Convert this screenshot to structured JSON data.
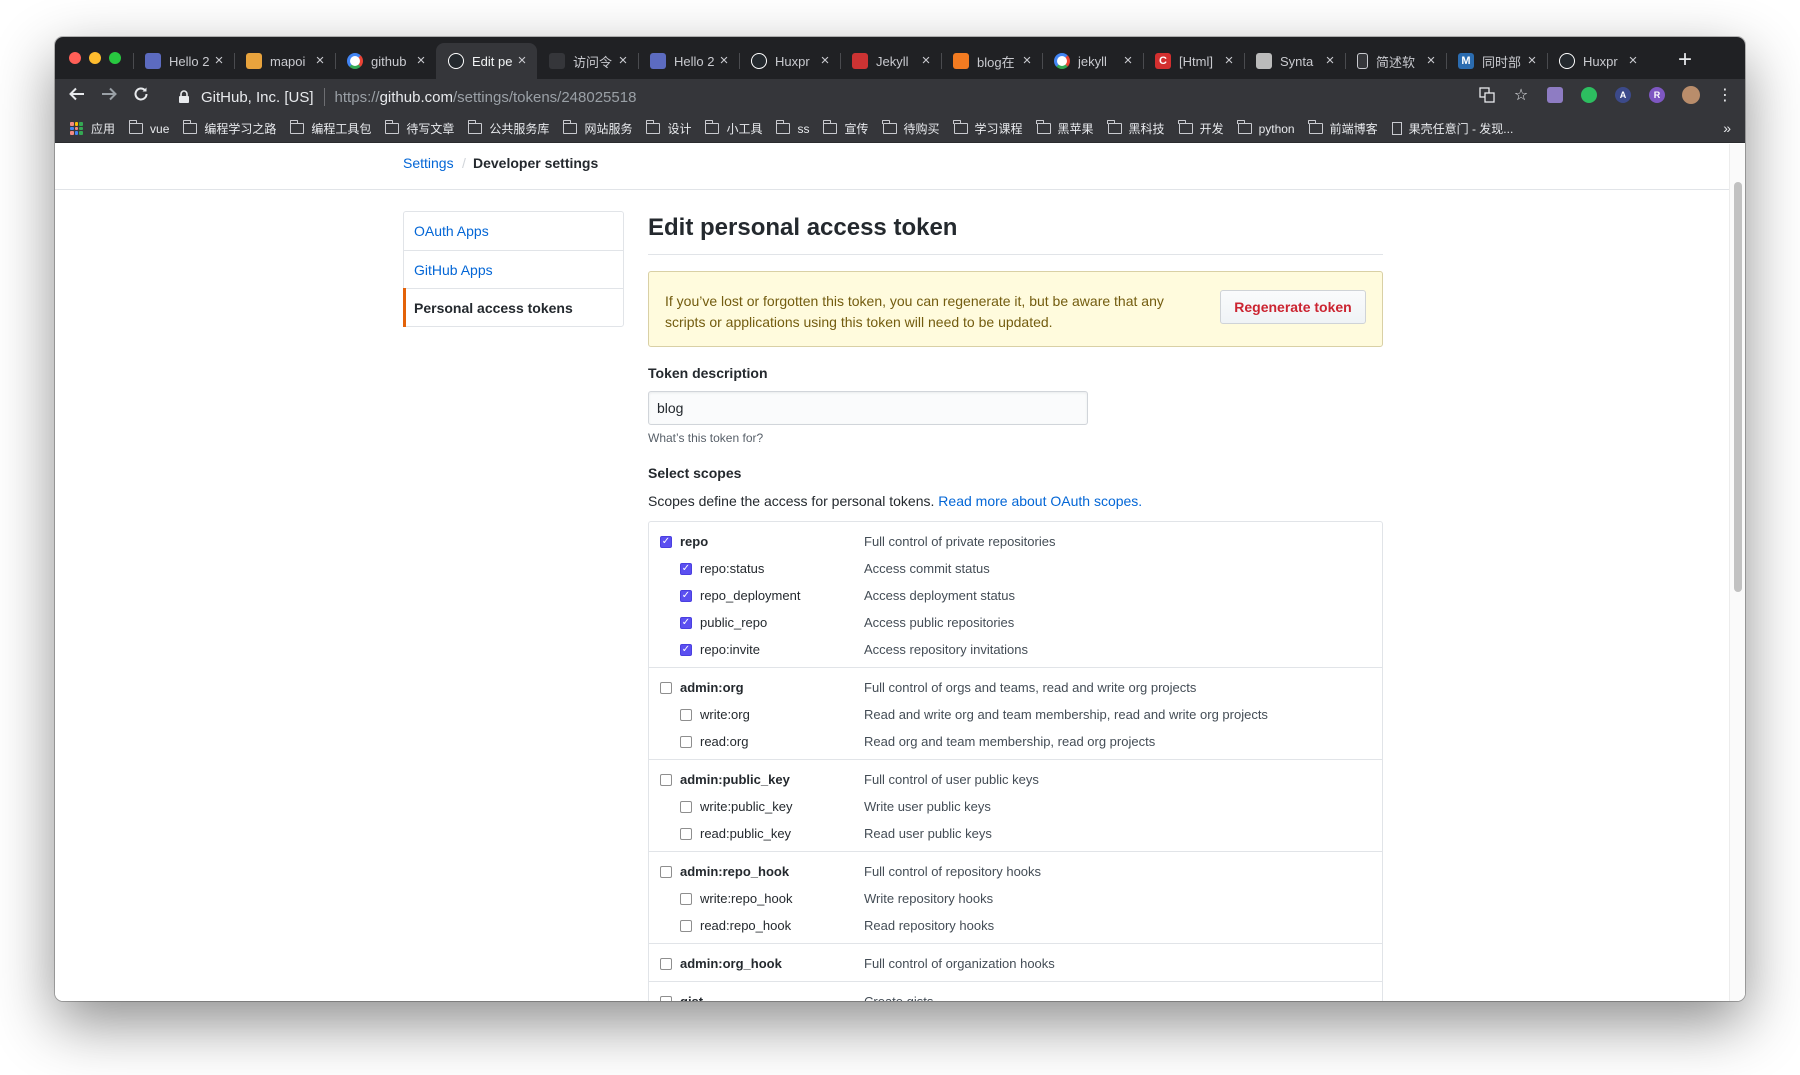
{
  "browser": {
    "tabs": [
      {
        "title": "Hello 2",
        "favicon": "app-icon",
        "color": "#5c6bc0",
        "active": false
      },
      {
        "title": "mapoi",
        "favicon": "map-icon",
        "color": "#e8a33d",
        "active": false
      },
      {
        "title": "github",
        "favicon": "google-icon",
        "color": "#ffffff",
        "active": false
      },
      {
        "title": "Edit pe",
        "favicon": "github-icon",
        "color": "#ffffff",
        "active": true
      },
      {
        "title": "访问令",
        "favicon": "blank-icon",
        "color": "#35363a",
        "active": false
      },
      {
        "title": "Hello 2",
        "favicon": "app-icon",
        "color": "#5c6bc0",
        "active": false
      },
      {
        "title": "Huxpr",
        "favicon": "github-icon",
        "color": "#ffffff",
        "active": false
      },
      {
        "title": "Jekyll",
        "favicon": "jekyll-icon",
        "color": "#cc3333",
        "active": false
      },
      {
        "title": "blog在",
        "favicon": "blog-icon",
        "color": "#f27b21",
        "active": false
      },
      {
        "title": "jekyll",
        "favicon": "google-icon",
        "color": "#ffffff",
        "active": false
      },
      {
        "title": "[Html]",
        "favicon": "c-icon",
        "color": "#d32f2f",
        "active": false
      },
      {
        "title": "Synta",
        "favicon": "syntax-icon",
        "color": "#bbbbbb",
        "active": false
      },
      {
        "title": "简述软",
        "favicon": "doc-icon",
        "color": "#35363a",
        "active": false
      },
      {
        "title": "同时部",
        "favicon": "m-icon",
        "color": "#2b6cb0",
        "active": false
      },
      {
        "title": "Huxpr",
        "favicon": "github-icon",
        "color": "#ffffff",
        "active": false
      }
    ],
    "site_identity": "GitHub, Inc. [US]",
    "url_scheme": "https://",
    "url_host": "github.com",
    "url_path": "/settings/tokens/248025518",
    "bookmarks": [
      {
        "label": "应用",
        "type": "apps"
      },
      {
        "label": "vue",
        "type": "folder"
      },
      {
        "label": "编程学习之路",
        "type": "folder"
      },
      {
        "label": "编程工具包",
        "type": "folder"
      },
      {
        "label": "待写文章",
        "type": "folder"
      },
      {
        "label": "公共服务库",
        "type": "folder"
      },
      {
        "label": "网站服务",
        "type": "folder"
      },
      {
        "label": "设计",
        "type": "folder"
      },
      {
        "label": "小工具",
        "type": "folder"
      },
      {
        "label": "ss",
        "type": "folder"
      },
      {
        "label": "宣传",
        "type": "folder"
      },
      {
        "label": "待购买",
        "type": "folder"
      },
      {
        "label": "学习课程",
        "type": "folder"
      },
      {
        "label": "黑苹果",
        "type": "folder"
      },
      {
        "label": "黑科技",
        "type": "folder"
      },
      {
        "label": "开发",
        "type": "folder"
      },
      {
        "label": "python",
        "type": "folder"
      },
      {
        "label": "前端博客",
        "type": "folder"
      },
      {
        "label": "果壳任意门 - 发现...",
        "type": "doc"
      }
    ],
    "more_bookmarks": "»"
  },
  "page": {
    "breadcrumb": {
      "settings": "Settings",
      "separator": "/",
      "current": "Developer settings"
    },
    "sidebar": [
      {
        "label": "OAuth Apps",
        "selected": false
      },
      {
        "label": "GitHub Apps",
        "selected": false
      },
      {
        "label": "Personal access tokens",
        "selected": true
      }
    ],
    "title": "Edit personal access token",
    "flash": {
      "text": "If you’ve lost or forgotten this token, you can regenerate it, but be aware that any scripts or applications using this token will need to be updated.",
      "button": "Regenerate token"
    },
    "token_description": {
      "label": "Token description",
      "value": "blog",
      "note": "What’s this token for?"
    },
    "scopes": {
      "label": "Select scopes",
      "description": "Scopes define the access for personal tokens.",
      "link": "Read more about OAuth scopes.",
      "groups": [
        {
          "name": "repo",
          "desc": "Full control of private repositories",
          "checked": true,
          "children": [
            {
              "name": "repo:status",
              "desc": "Access commit status",
              "checked": true
            },
            {
              "name": "repo_deployment",
              "desc": "Access deployment status",
              "checked": true
            },
            {
              "name": "public_repo",
              "desc": "Access public repositories",
              "checked": true
            },
            {
              "name": "repo:invite",
              "desc": "Access repository invitations",
              "checked": true
            }
          ]
        },
        {
          "name": "admin:org",
          "desc": "Full control of orgs and teams, read and write org projects",
          "checked": false,
          "children": [
            {
              "name": "write:org",
              "desc": "Read and write org and team membership, read and write org projects",
              "checked": false
            },
            {
              "name": "read:org",
              "desc": "Read org and team membership, read org projects",
              "checked": false
            }
          ]
        },
        {
          "name": "admin:public_key",
          "desc": "Full control of user public keys",
          "checked": false,
          "children": [
            {
              "name": "write:public_key",
              "desc": "Write user public keys",
              "checked": false
            },
            {
              "name": "read:public_key",
              "desc": "Read user public keys",
              "checked": false
            }
          ]
        },
        {
          "name": "admin:repo_hook",
          "desc": "Full control of repository hooks",
          "checked": false,
          "children": [
            {
              "name": "write:repo_hook",
              "desc": "Write repository hooks",
              "checked": false
            },
            {
              "name": "read:repo_hook",
              "desc": "Read repository hooks",
              "checked": false
            }
          ]
        },
        {
          "name": "admin:org_hook",
          "desc": "Full control of organization hooks",
          "checked": false,
          "children": []
        },
        {
          "name": "gist",
          "desc": "Create gists",
          "checked": false,
          "children": []
        }
      ]
    }
  }
}
